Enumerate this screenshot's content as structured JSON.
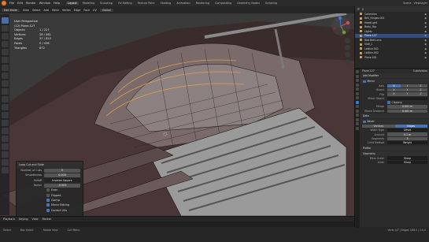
{
  "topbar": {
    "menus": [
      "File",
      "Edit",
      "Render",
      "Window",
      "Help"
    ],
    "workspaces": [
      "Layout",
      "Modeling",
      "Sculpting",
      "UV Editing",
      "Texture Paint",
      "Shading",
      "Animation",
      "Rendering",
      "Compositing",
      "Geometry Nodes",
      "Scripting"
    ],
    "active_workspace": "Layout",
    "scene": "Scene",
    "view_layer": "ViewLayer"
  },
  "viewport_header": {
    "mode": "Edit Mode",
    "menus": [
      "View",
      "Select",
      "Add",
      "Mesh",
      "Vertex",
      "Edge",
      "Face",
      "UV"
    ],
    "orientation": "Global"
  },
  "stats": {
    "view_name": "User Perspective",
    "object_name": "(12) Plane.127",
    "rows": [
      {
        "label": "Objects",
        "value": "1 / 227"
      },
      {
        "label": "Vertices",
        "value": "28 / 461"
      },
      {
        "label": "Edges",
        "value": "37 / 815"
      },
      {
        "label": "Faces",
        "value": "0 / 436"
      },
      {
        "label": "Triangles",
        "value": "872"
      }
    ]
  },
  "operator_panel": {
    "title": "Loop Cut and Slide",
    "rows": [
      {
        "label": "Number of Cuts",
        "value": "5"
      },
      {
        "label": "Smoothness",
        "value": "0.000"
      },
      {
        "label": "Falloff",
        "value": "Inverse Square"
      },
      {
        "label": "Factor",
        "value": "-0.503"
      }
    ],
    "checks": [
      {
        "label": "Even",
        "on": false
      },
      {
        "label": "Flipped",
        "on": false
      },
      {
        "label": "Clamp",
        "on": true
      },
      {
        "label": "Mirror Editing",
        "on": true
      },
      {
        "label": "Correct UVs",
        "on": true
      }
    ]
  },
  "timeline": {
    "menus": [
      "Playback",
      "Keying",
      "View",
      "Marker"
    ],
    "frame": "12"
  },
  "statusbar": {
    "left": "Select",
    "mid1": "Box Select",
    "mid2": "Rotate View",
    "mid3": "Call Menu",
    "version": "Verts 0/7 | Edges 0/815 | 3.0.0"
  },
  "outliner": {
    "items": [
      {
        "label": "Collection",
        "sel": false
      },
      {
        "label": "Bell_Hinges.001",
        "sel": false
      },
      {
        "label": "HeadLight",
        "sel": false
      },
      {
        "label": "Body_Top",
        "sel": false
      },
      {
        "label": "Lights",
        "sel": false
      },
      {
        "label": "Plane.127",
        "sel": true
      },
      {
        "label": "Red.Refl.Lens",
        "sel": false
      },
      {
        "label": "Side_L",
        "sel": false
      },
      {
        "label": "Lattice.001",
        "sel": false
      },
      {
        "label": "Lattice.002",
        "sel": false
      },
      {
        "label": "Plane.001",
        "sel": false
      }
    ]
  },
  "properties": {
    "object_name": "Plane.127",
    "modifier_name": "Subdivision",
    "array_title": "Add Modifier",
    "mirror_label": "Mirror",
    "axis_row": {
      "k": "Axis",
      "vals": [
        "X",
        "Y",
        "Z"
      ]
    },
    "bisect_row": {
      "k": "Bisect",
      "vals": [
        "X",
        "Y",
        "Z"
      ]
    },
    "flip_row": {
      "k": "Flip",
      "vals": [
        "X",
        "Y",
        "Z"
      ]
    },
    "mirror_object": "Mirror Object",
    "clipping": "Clipping",
    "merge_label": "Merge",
    "merge_value": "0.001 m",
    "bisect_distance": "Bisect Distance",
    "bisect_value": "0.001 m",
    "data_label": "Data",
    "bevel_label": "Bevel",
    "seg_labels": [
      "Vertices",
      "Edges"
    ],
    "width_type": {
      "k": "Width Type",
      "v": "Offset"
    },
    "amount": {
      "k": "Amount",
      "v": "0.1 m"
    },
    "segments": {
      "k": "Segments",
      "v": "3"
    },
    "limit_method": {
      "k": "Limit Method",
      "v": "Weight"
    },
    "profile": "Profile",
    "geometry": "Geometry",
    "miter_outer": {
      "k": "Miter Outer",
      "v": "Sharp"
    },
    "inner": {
      "k": "Inner",
      "v": "Sharp"
    }
  },
  "colors": {
    "accent": "#4772b3",
    "selected_row": "#334d80",
    "logo": "#e67e22"
  }
}
